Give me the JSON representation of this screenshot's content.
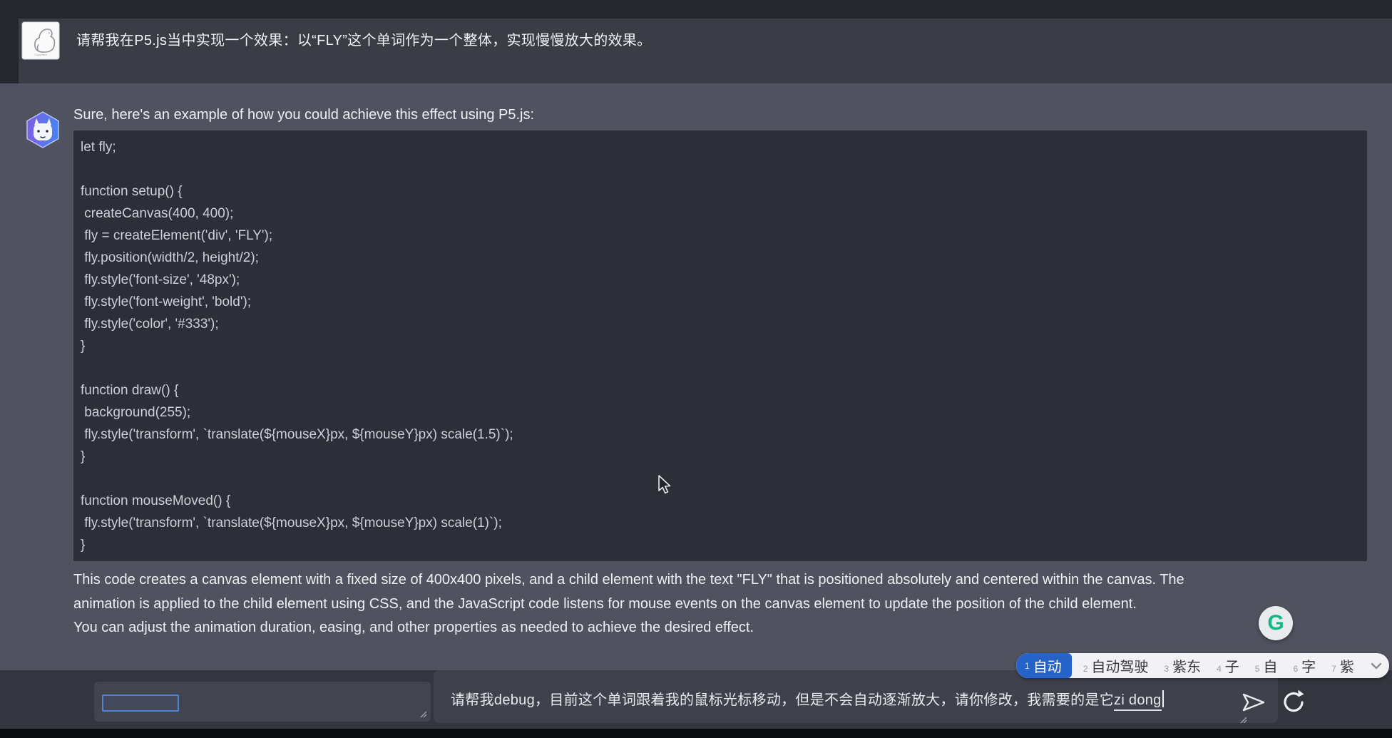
{
  "user_message": {
    "text": "请帮我在P5.js当中实现一个效果：以“FLY”这个单词作为一个整体，实现慢慢放大的效果。"
  },
  "assistant": {
    "intro": "Sure, here's an example of how you could achieve this effect using P5.js:",
    "code_lines": [
      "let fly;",
      "",
      "function setup() {",
      " createCanvas(400, 400);",
      " fly = createElement('div', 'FLY');",
      " fly.position(width/2, height/2);",
      " fly.style('font-size', '48px');",
      " fly.style('font-weight', 'bold');",
      " fly.style('color', '#333');",
      "}",
      "",
      "function draw() {",
      " background(255);",
      " fly.style('transform', `translate(${mouseX}px, ${mouseY}px) scale(1.5)`);",
      "}",
      "",
      "function mouseMoved() {",
      " fly.style('transform', `translate(${mouseX}px, ${mouseY}px) scale(1)`);",
      "}"
    ],
    "explanation_lines": [
      "This code creates a canvas element with a fixed size of 400x400 pixels, and a child element with the text \"FLY\" that is positioned absolutely and centered within the canvas. The",
      "animation is applied to the child element using CSS, and the JavaScript code listens for mouse events on the canvas element to update the position of the child element.",
      "You can adjust the animation duration, easing, and other properties as needed to achieve the desired effect."
    ]
  },
  "grammarly": {
    "letter": "G",
    "brand_color": "#12b886"
  },
  "ime": {
    "candidates": [
      {
        "num": "1",
        "label": "自动",
        "selected": true
      },
      {
        "num": "2",
        "label": "自动驾驶",
        "selected": false
      },
      {
        "num": "3",
        "label": "紫东",
        "selected": false
      },
      {
        "num": "4",
        "label": "子",
        "selected": false
      },
      {
        "num": "5",
        "label": "自",
        "selected": false
      },
      {
        "num": "6",
        "label": "字",
        "selected": false
      },
      {
        "num": "7",
        "label": "紫",
        "selected": false
      }
    ],
    "selected_bg": "#2563c9"
  },
  "composer": {
    "input_before": "请帮我debug，目前这个单词跟着我的鼠标光标移动，但是不会自动逐渐放大，请你修改，我需要的是它",
    "input_composition": "zi dong"
  },
  "colors": {
    "top_bar": "#3a3c46",
    "main_bg": "#50535f",
    "code_bg": "#2c2f38",
    "bottom_bar": "#34363f",
    "ime_selected": "#2563c9",
    "focus_blue": "#4f83d9"
  }
}
